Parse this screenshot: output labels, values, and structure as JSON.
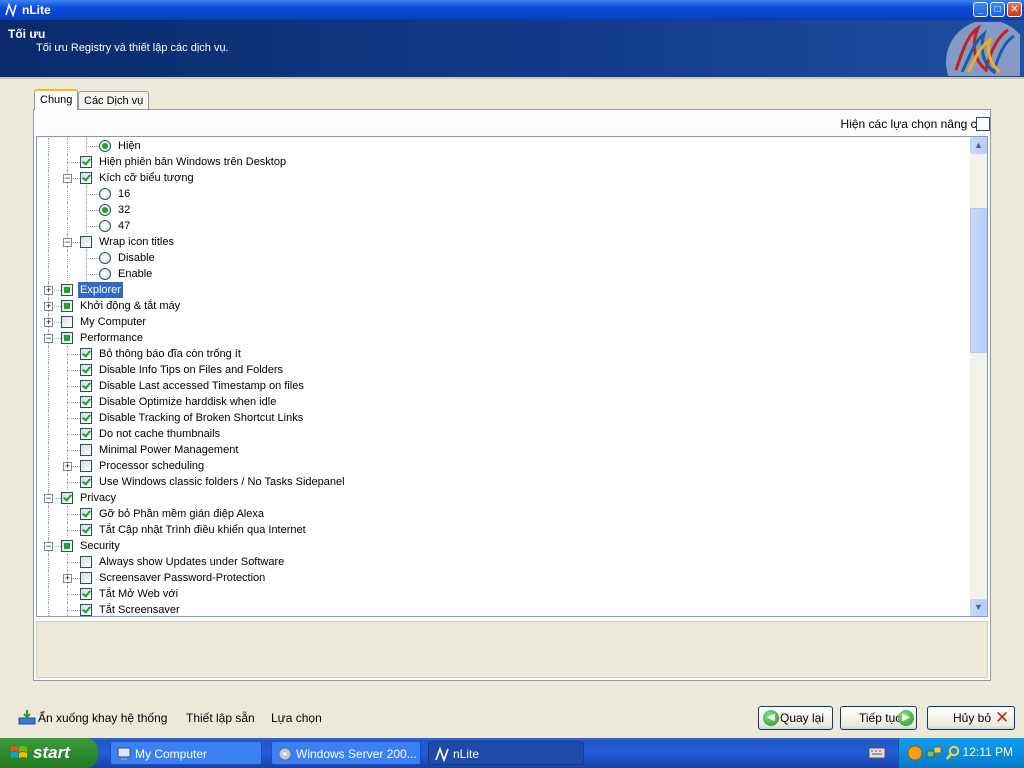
{
  "window": {
    "title": "nLite",
    "header_title": "Tối ưu",
    "header_subtitle": "Tối ưu Registry và thiết lập các dịch vụ.",
    "controls": {
      "minimize": "_",
      "maximize": "□",
      "close": "✕"
    }
  },
  "tabs": [
    {
      "label": "Chung",
      "active": true
    },
    {
      "label": "Các Dịch vụ",
      "active": false
    }
  ],
  "advanced_label": "Hiện các lựa chọn nâng cao",
  "tree": [
    {
      "label": "Hiện",
      "type": "radio",
      "checked": true,
      "level": 3
    },
    {
      "label": "Hiện phiên bản Windows trên Desktop",
      "type": "check",
      "checked": true,
      "level": 2
    },
    {
      "label": "Kích cỡ biểu tượng",
      "type": "check",
      "checked": true,
      "level": 2,
      "expander": "minus"
    },
    {
      "label": "16",
      "type": "radio",
      "checked": false,
      "level": 3
    },
    {
      "label": "32",
      "type": "radio",
      "checked": true,
      "level": 3
    },
    {
      "label": "47",
      "type": "radio",
      "checked": false,
      "level": 3
    },
    {
      "label": "Wrap icon titles",
      "type": "check",
      "checked": false,
      "level": 2,
      "expander": "minus"
    },
    {
      "label": "Disable",
      "type": "radio",
      "checked": false,
      "level": 3
    },
    {
      "label": "Enable",
      "type": "radio",
      "checked": false,
      "level": 3
    },
    {
      "label": "Explorer",
      "type": "check",
      "state": "partial",
      "level": 1,
      "expander": "plus",
      "selected": true
    },
    {
      "label": "Khởi động & tắt máy",
      "type": "check",
      "state": "partial",
      "level": 1,
      "expander": "plus"
    },
    {
      "label": "My Computer",
      "type": "check",
      "checked": false,
      "level": 1,
      "expander": "plus"
    },
    {
      "label": "Performance",
      "type": "check",
      "state": "partial",
      "level": 1,
      "expander": "minus"
    },
    {
      "label": "Bỏ thông báo đĩa còn trống ít",
      "type": "check",
      "checked": true,
      "level": 2
    },
    {
      "label": "Disable Info Tips on Files and Folders",
      "type": "check",
      "checked": true,
      "level": 2
    },
    {
      "label": "Disable Last accessed Timestamp on files",
      "type": "check",
      "checked": true,
      "level": 2
    },
    {
      "label": "Disable Optimize harddisk when idle",
      "type": "check",
      "checked": true,
      "level": 2
    },
    {
      "label": "Disable Tracking of Broken Shortcut Links",
      "type": "check",
      "checked": true,
      "level": 2
    },
    {
      "label": "Do not cache thumbnails",
      "type": "check",
      "checked": true,
      "level": 2
    },
    {
      "label": "Minimal Power Management",
      "type": "check",
      "checked": false,
      "level": 2
    },
    {
      "label": "Processor scheduling",
      "type": "check",
      "checked": false,
      "level": 2,
      "expander": "plus"
    },
    {
      "label": "Use Windows classic folders / No Tasks Sidepanel",
      "type": "check",
      "checked": true,
      "level": 2
    },
    {
      "label": "Privacy",
      "type": "check",
      "checked": true,
      "level": 1,
      "expander": "minus"
    },
    {
      "label": "Gỡ bỏ Phần mềm gián điệp Alexa",
      "type": "check",
      "checked": true,
      "level": 2
    },
    {
      "label": "Tắt Cập nhật Trình điều khiển qua Internet",
      "type": "check",
      "checked": true,
      "level": 2
    },
    {
      "label": "Security",
      "type": "check",
      "state": "partial",
      "level": 1,
      "expander": "minus"
    },
    {
      "label": "Always show Updates under Software",
      "type": "check",
      "checked": false,
      "level": 2
    },
    {
      "label": "Screensaver Password-Protection",
      "type": "check",
      "checked": false,
      "level": 2,
      "expander": "plus"
    },
    {
      "label": "Tắt Mở Web với",
      "type": "check",
      "checked": true,
      "level": 2
    },
    {
      "label": "Tắt Screensaver",
      "type": "check",
      "checked": true,
      "level": 2
    }
  ],
  "bottom": {
    "tray_link": "Ẩn xuống khay hệ thống",
    "presets": "Thiết lập sẵn",
    "options": "Lựa chọn",
    "back": "Quay lại",
    "next": "Tiếp tục",
    "cancel": "Hủy bỏ"
  },
  "taskbar": {
    "start": "start",
    "tasks": [
      {
        "label": "My Computer",
        "active": false
      },
      {
        "label": "Windows Server 200...",
        "active": false
      },
      {
        "label": "nLite",
        "active": true
      }
    ],
    "clock": "12:11 PM"
  }
}
